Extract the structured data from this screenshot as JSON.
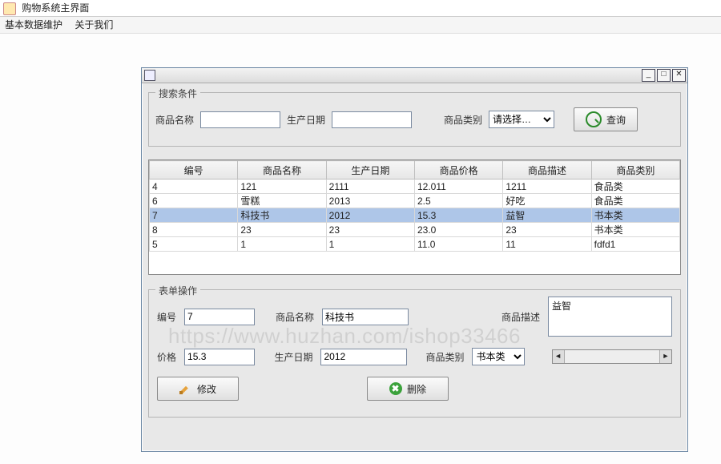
{
  "app": {
    "title": "购物系统主界面"
  },
  "menu": {
    "items": [
      "基本数据维护",
      "关于我们"
    ]
  },
  "internal_window": {
    "controls": {
      "min": "_",
      "max": "□",
      "close": "×"
    }
  },
  "search_panel": {
    "legend": "搜索条件",
    "name_label": "商品名称",
    "name_value": "",
    "date_label": "生产日期",
    "date_value": "",
    "category_label": "商品类别",
    "category_value": "请选择…",
    "query_button": "查询"
  },
  "table": {
    "headers": [
      "编号",
      "商品名称",
      "生产日期",
      "商品价格",
      "商品描述",
      "商品类别"
    ],
    "rows": [
      {
        "cells": [
          "4",
          "121",
          "2111",
          "12.011",
          "1211",
          "食品类"
        ],
        "selected": false
      },
      {
        "cells": [
          "6",
          "雪糕",
          "2013",
          "2.5",
          "好吃",
          "食品类"
        ],
        "selected": false
      },
      {
        "cells": [
          "7",
          "科技书",
          "2012",
          "15.3",
          "益智",
          "书本类"
        ],
        "selected": true
      },
      {
        "cells": [
          "8",
          "23",
          "23",
          "23.0",
          "23",
          "书本类"
        ],
        "selected": false
      },
      {
        "cells": [
          "5",
          "1",
          "1",
          "11.0",
          "11",
          "fdfd1"
        ],
        "selected": false
      }
    ]
  },
  "form_panel": {
    "legend": "表单操作",
    "id_label": "编号",
    "id_value": "7",
    "name_label": "商品名称",
    "name_value": "科技书",
    "desc_label": "商品描述",
    "desc_value": "益智",
    "price_label": "价格",
    "price_value": "15.3",
    "date_label": "生产日期",
    "date_value": "2012",
    "category_label": "商品类别",
    "category_value": "书本类",
    "modify_button": "修改",
    "delete_button": "删除"
  },
  "watermark": "https://www.huzhan.com/ishop33466"
}
